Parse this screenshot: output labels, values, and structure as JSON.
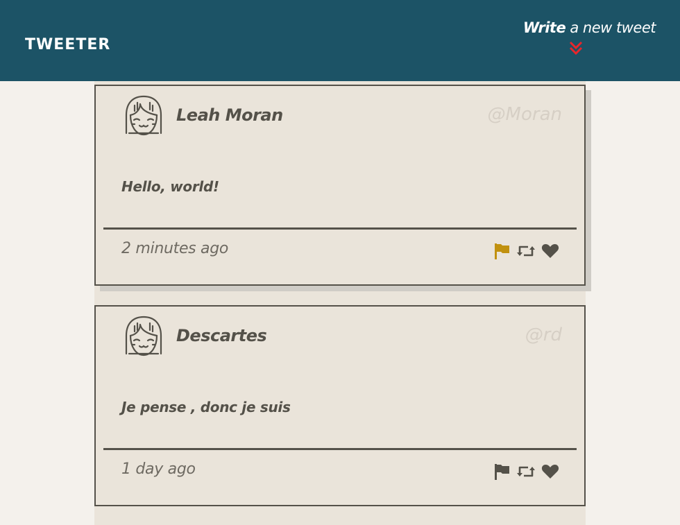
{
  "nav": {
    "brand": "TWEETER",
    "compose_strong": "Write",
    "compose_rest": " a new tweet",
    "chevron_icon": "double-chevron-down-icon",
    "chevron_color": "#e8262b"
  },
  "tweets": [
    {
      "name": "Leah Moran",
      "handle": "@Moran",
      "content": "Hello, world!",
      "time": "2 minutes ago",
      "flag_color": "#c1910f",
      "icons": [
        "flag-icon",
        "retweet-icon",
        "heart-icon"
      ]
    },
    {
      "name": "Descartes",
      "handle": "@rd",
      "content": "Je pense , donc je suis",
      "time": "1 day ago",
      "flag_color": "#545149",
      "icons": [
        "flag-icon",
        "retweet-icon",
        "heart-icon"
      ]
    }
  ],
  "colors": {
    "nav_bg": "#1c5366",
    "card_bg": "#eae4da",
    "text_dark": "#545149",
    "handle_muted": "#d6cfc5"
  }
}
